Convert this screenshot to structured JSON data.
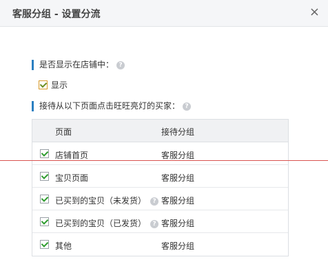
{
  "dialog": {
    "title": "客服分组 - 设置分流",
    "close_glyph": "×"
  },
  "display_section": {
    "label": "是否显示在店铺中：",
    "checkbox_label": "显示",
    "checked": true
  },
  "receive_section": {
    "label": "接待从以下页面点击旺旺亮灯的买家："
  },
  "table": {
    "headers": [
      "页面",
      "接待分组"
    ],
    "rows": [
      {
        "page": "店铺首页",
        "group": "客服分组",
        "checked": true,
        "help": false
      },
      {
        "page": "宝贝页面",
        "group": "客服分组",
        "checked": true,
        "help": false
      },
      {
        "page": "已买到的宝贝（未发货）",
        "group": "客服分组",
        "checked": true,
        "help": true
      },
      {
        "page": "已买到的宝贝（已发货）",
        "group": "客服分组",
        "checked": true,
        "help": true
      },
      {
        "page": "其他",
        "group": "客服分组",
        "checked": true,
        "help": false
      }
    ]
  },
  "colors": {
    "accent": "#2a7fc1",
    "titlebar": "#f5f6f8",
    "annotation_line": "#d9534f"
  }
}
